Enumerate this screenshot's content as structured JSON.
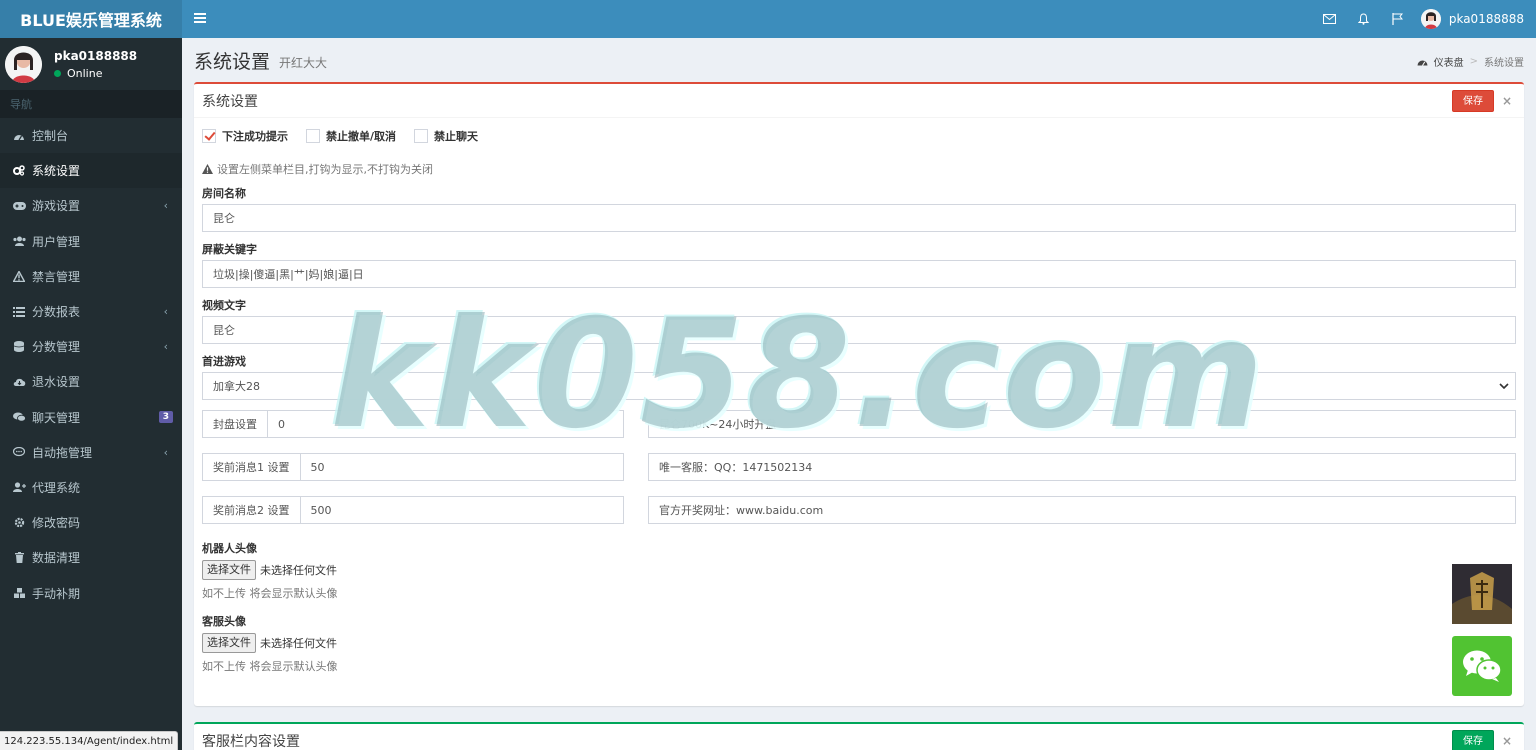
{
  "header": {
    "logo": "BLUE娱乐管理系统",
    "user_name": "pka0188888"
  },
  "sidebar": {
    "user_name": "pka0188888",
    "status": "Online",
    "nav_header": "导航",
    "items": [
      {
        "label": "控制台"
      },
      {
        "label": "系统设置"
      },
      {
        "label": "游戏设置"
      },
      {
        "label": "用户管理"
      },
      {
        "label": "禁言管理"
      },
      {
        "label": "分数报表"
      },
      {
        "label": "分数管理"
      },
      {
        "label": "退水设置"
      },
      {
        "label": "聊天管理",
        "badge": "3"
      },
      {
        "label": "自动拖管理"
      },
      {
        "label": "代理系统"
      },
      {
        "label": "修改密码"
      },
      {
        "label": "数据清理"
      },
      {
        "label": "手动补期"
      }
    ]
  },
  "page": {
    "title": "系统设置",
    "subtitle": "开红大大",
    "breadcrumb": [
      "仪表盘",
      "系统设置"
    ]
  },
  "box": {
    "title": "系统设置",
    "save_label": "保存",
    "close_label": "×",
    "checkboxes": [
      {
        "label": "下注成功提示",
        "checked": true
      },
      {
        "label": "禁止撤单/取消",
        "checked": false
      },
      {
        "label": "禁止聊天",
        "checked": false
      }
    ],
    "hint": "设置左侧菜单栏目,打钩为显示,不打钩为关闭",
    "room_name_label": "房间名称",
    "room_name_value": "昆仑",
    "keywords_label": "屏蔽关键字",
    "keywords_value": "垃圾|操|傻逼|黑|艹|妈|娘|逼|日",
    "video_text_label": "视频文字",
    "video_text_value": "昆仑",
    "first_game_label": "首进游戏",
    "first_game_value": "加拿大28",
    "close_setting_label": "封盘设置",
    "close_setting_value": "0",
    "close_setting_text": "昆仑700K~24小时开盘",
    "pre_msg1_label": "奖前消息1 设置",
    "pre_msg1_value": "50",
    "pre_msg1_text": "唯一客服：QQ：1471502134",
    "pre_msg2_label": "奖前消息2 设置",
    "pre_msg2_value": "500",
    "pre_msg2_text": "官方开奖网址：www.baidu.com",
    "robot_avatar_label": "机器人头像",
    "file_button": "选择文件",
    "file_none": "未选择任何文件",
    "upload_help": "如不上传 将会显示默认头像",
    "service_avatar_label": "客服头像"
  },
  "box2": {
    "title": "客服栏内容设置",
    "save_label": "保存",
    "close_label": "×"
  },
  "watermark": "kk058.com",
  "statusbar": "124.223.55.134/Agent/index.html",
  "colors": {
    "header": "#3c8dbc",
    "sidebar": "#222d32",
    "danger": "#dd4b39",
    "success": "#00a65a"
  }
}
